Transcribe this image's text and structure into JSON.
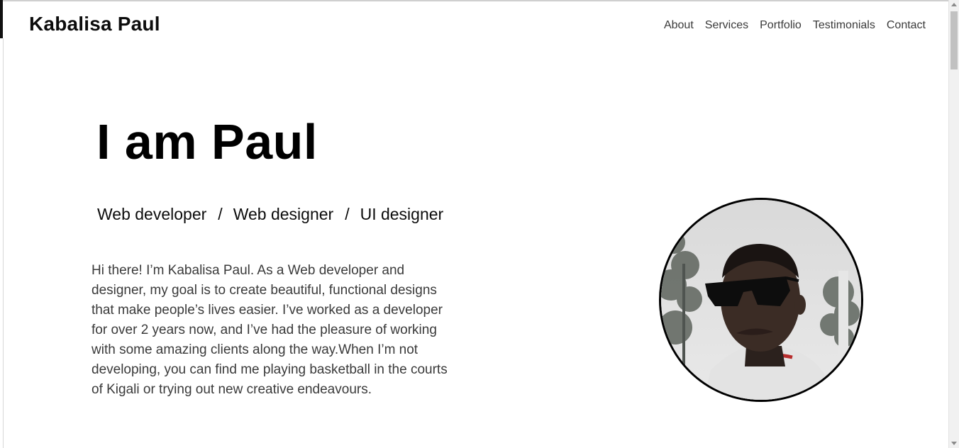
{
  "header": {
    "brand": "Kabalisa Paul",
    "nav": [
      "About",
      "Services",
      "Portfolio",
      "Testimonials",
      "Contact"
    ]
  },
  "hero": {
    "title": "I am Paul",
    "roles": [
      "Web developer",
      "Web designer",
      "UI designer"
    ],
    "separator": "/",
    "bio": "Hi there! I’m Kabalisa Paul. As a Web developer and designer, my goal is to create beautiful, functional designs that make people’s lives easier. I’ve worked as a developer for over 2 years now, and I’ve had the pleasure of working with some amazing clients along the way.When I’m not developing, you can find me playing basketball in the courts of Kigali or trying out new creative endeavours."
  },
  "colors": {
    "text": "#0c0c0c",
    "muted_text": "#3a3a3a",
    "background": "#ffffff",
    "avatar_border": "#000000"
  },
  "icons": {
    "profile_photo": "profile-photo"
  }
}
